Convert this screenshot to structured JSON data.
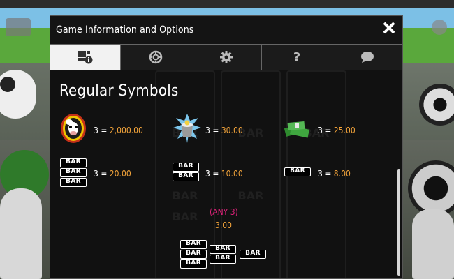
{
  "dialog": {
    "title": "Game Information and Options",
    "tabs": [
      {
        "name": "paytable",
        "icon": "paytable-info-icon",
        "active": true
      },
      {
        "name": "chip",
        "icon": "casino-chip-icon",
        "active": false
      },
      {
        "name": "settings",
        "icon": "gear-icon",
        "active": false
      },
      {
        "name": "help",
        "icon": "question-mark-icon",
        "label": "?",
        "active": false
      },
      {
        "name": "chat",
        "icon": "speech-bubble-icon",
        "active": false
      }
    ]
  },
  "section": {
    "title": "Regular Symbols"
  },
  "symbols": [
    {
      "symbol": "cow-wild-icon",
      "count": "3",
      "eq": "=",
      "payout": "2,000.00"
    },
    {
      "symbol": "milk-bucket-icon",
      "count": "3",
      "eq": "=",
      "payout": "30.00"
    },
    {
      "symbol": "cash-stack-icon",
      "count": "3",
      "eq": "=",
      "payout": "25.00"
    },
    {
      "symbol": "triple-bar-icon",
      "count": "3",
      "eq": "=",
      "payout": "20.00"
    },
    {
      "symbol": "double-bar-icon",
      "count": "3",
      "eq": "=",
      "payout": "10.00"
    },
    {
      "symbol": "single-bar-icon",
      "count": "3",
      "eq": "=",
      "payout": "8.00"
    }
  ],
  "any_bar": {
    "label": "(ANY 3)",
    "payout": "3.00"
  },
  "bar_text": "BAR",
  "colors": {
    "payout": "#f2a33a",
    "any_label": "#e0227a",
    "active_tab": "#f2f2f2",
    "dialog_bg": "#111111"
  }
}
